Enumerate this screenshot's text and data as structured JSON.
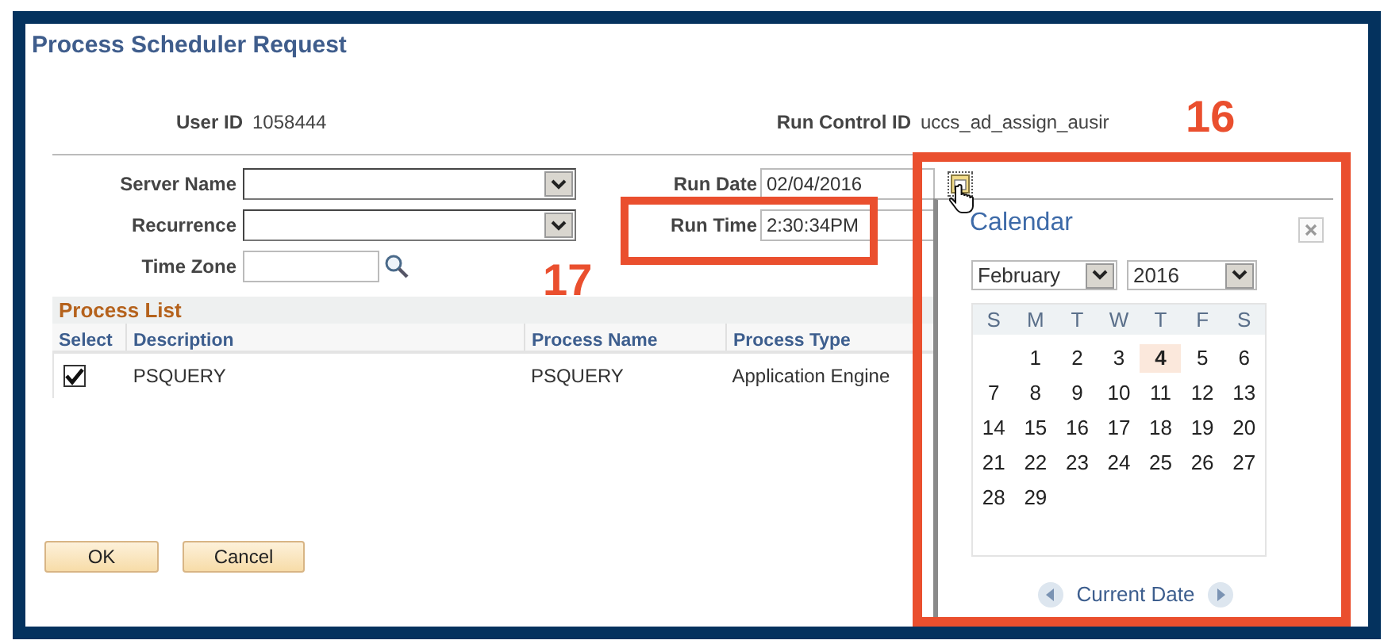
{
  "title": "Process Scheduler Request",
  "user_id": {
    "label": "User ID",
    "value": "1058444"
  },
  "run_control_id": {
    "label": "Run Control ID",
    "value": "uccs_ad_assign_ausir"
  },
  "fields": [
    {
      "label": "Server Name",
      "kind": "select"
    },
    {
      "label": "Recurrence",
      "kind": "select"
    },
    {
      "label": "Time Zone",
      "kind": "lookup"
    }
  ],
  "run_fields": [
    {
      "label": "Run Date",
      "value": "02/04/2016",
      "kind": "date"
    },
    {
      "label": "Run Time",
      "value": "2:30:34PM",
      "kind": "time"
    }
  ],
  "process_list": {
    "title": "Process List",
    "columns": [
      "Select",
      "Description",
      "Process Name",
      "Process Type"
    ],
    "rows": [
      {
        "checked": true,
        "description": "PSQUERY",
        "process_name": "PSQUERY",
        "process_type": "Application Engine"
      }
    ]
  },
  "buttons": [
    "OK",
    "Cancel"
  ],
  "calendar": {
    "title": "Calendar",
    "month": "February",
    "year": "2016",
    "weekdays": [
      "S",
      "M",
      "T",
      "W",
      "T",
      "F",
      "S"
    ],
    "weeks": [
      [
        {
          "day": "1",
          "selected": false
        },
        {
          "day": "2",
          "selected": false
        },
        {
          "day": "3",
          "selected": false
        },
        {
          "day": "4",
          "selected": true
        },
        {
          "day": "5",
          "selected": false
        },
        {
          "day": "6",
          "selected": false
        }
      ],
      [
        {
          "day": "7",
          "selected": false
        },
        {
          "day": "8",
          "selected": false
        },
        {
          "day": "9",
          "selected": false
        },
        {
          "day": "10",
          "selected": false
        },
        {
          "day": "11",
          "selected": false
        },
        {
          "day": "12",
          "selected": false
        },
        {
          "day": "13",
          "selected": false
        }
      ],
      [
        {
          "day": "14",
          "selected": false
        },
        {
          "day": "15",
          "selected": false
        },
        {
          "day": "16",
          "selected": false
        },
        {
          "day": "17",
          "selected": false
        },
        {
          "day": "18",
          "selected": false
        },
        {
          "day": "19",
          "selected": false
        },
        {
          "day": "20",
          "selected": false
        }
      ],
      [
        {
          "day": "21",
          "selected": false
        },
        {
          "day": "22",
          "selected": false
        },
        {
          "day": "23",
          "selected": false
        },
        {
          "day": "24",
          "selected": false
        },
        {
          "day": "25",
          "selected": false
        },
        {
          "day": "26",
          "selected": false
        },
        {
          "day": "27",
          "selected": false
        }
      ],
      [
        {
          "day": "28",
          "selected": false
        },
        {
          "day": "29",
          "selected": false
        }
      ]
    ],
    "current_date": "Current Date"
  },
  "annotations": [
    {
      "label": "16"
    },
    {
      "label": "17"
    }
  ]
}
